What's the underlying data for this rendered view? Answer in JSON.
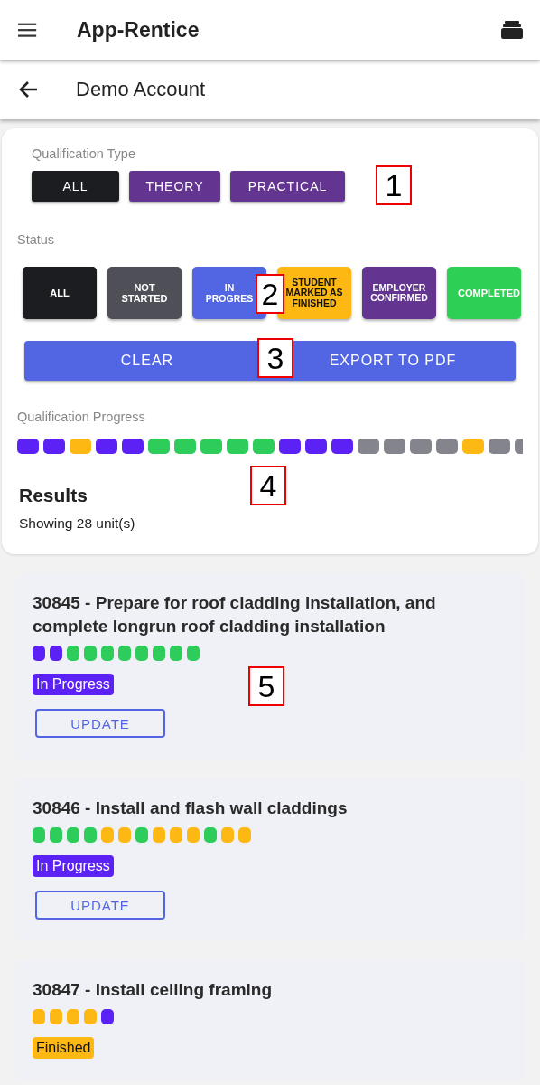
{
  "app_bar": {
    "title": "App-Rentice"
  },
  "page_header": {
    "title": "Demo Account"
  },
  "filters": {
    "qualification_label": "Qualification Type",
    "qualification_types": [
      {
        "label": "ALL",
        "selected": true
      },
      {
        "label": "THEORY",
        "selected": false
      },
      {
        "label": "PRACTICAL",
        "selected": false
      }
    ],
    "status_label": "Status",
    "statuses": [
      {
        "label": "ALL",
        "selected": true,
        "color": "#1c1d21"
      },
      {
        "label": "NOT STARTED",
        "selected": false,
        "color": "#4f5057"
      },
      {
        "label": "IN PROGRES",
        "selected": false,
        "color": "#5266e3"
      },
      {
        "label": "STUDENT MARKED AS FINISHED",
        "selected": false,
        "color": "#fdb813"
      },
      {
        "label": "EMPLOYER CONFIRMED",
        "selected": false,
        "color": "#633590"
      },
      {
        "label": "COMPLETED",
        "selected": false,
        "color": "#2ecf55"
      }
    ],
    "actions": [
      "CLEAR",
      "EXPORT TO PDF"
    ]
  },
  "progress": {
    "label": "Qualification Progress",
    "segments": [
      {
        "color": "#5b21f5"
      },
      {
        "color": "#5b21f5"
      },
      {
        "color": "#fdb813"
      },
      {
        "color": "#5b21f5"
      },
      {
        "color": "#5b21f5"
      },
      {
        "color": "#2ecc5a"
      },
      {
        "color": "#2ecc5a"
      },
      {
        "color": "#2ecc5a"
      },
      {
        "color": "#2ecc5a"
      },
      {
        "color": "#2ecc5a"
      },
      {
        "color": "#5b21f5"
      },
      {
        "color": "#5b21f5"
      },
      {
        "color": "#5b21f5"
      },
      {
        "color": "#84848c"
      },
      {
        "color": "#84848c"
      },
      {
        "color": "#84848c"
      },
      {
        "color": "#84848c"
      },
      {
        "color": "#fdb813"
      },
      {
        "color": "#84848c"
      },
      {
        "color": "#84848c"
      }
    ]
  },
  "results": {
    "title": "Results",
    "summary": "Showing 28 unit(s)"
  },
  "units": [
    {
      "title": "30845 - Prepare for roof cladding installation, and complete longrun roof cladding installation",
      "status": {
        "text": "In Progress",
        "color": "#5b21f5"
      },
      "button": "UPDATE",
      "segments": [
        {
          "color": "#5b21f5"
        },
        {
          "color": "#5b21f5"
        },
        {
          "color": "#2ecc5a"
        },
        {
          "color": "#2ecc5a"
        },
        {
          "color": "#2ecc5a"
        },
        {
          "color": "#2ecc5a"
        },
        {
          "color": "#2ecc5a"
        },
        {
          "color": "#2ecc5a"
        },
        {
          "color": "#2ecc5a"
        },
        {
          "color": "#2ecc5a"
        }
      ]
    },
    {
      "title": "30846 - Install and flash wall claddings",
      "status": {
        "text": "In Progress",
        "color": "#5b21f5"
      },
      "button": "UPDATE",
      "segments": [
        {
          "color": "#2ecc5a"
        },
        {
          "color": "#2ecc5a"
        },
        {
          "color": "#2ecc5a"
        },
        {
          "color": "#2ecc5a"
        },
        {
          "color": "#fdb813"
        },
        {
          "color": "#fdb813"
        },
        {
          "color": "#2ecc5a"
        },
        {
          "color": "#fdb813"
        },
        {
          "color": "#fdb813"
        },
        {
          "color": "#fdb813"
        },
        {
          "color": "#2ecc5a"
        },
        {
          "color": "#fdb813"
        },
        {
          "color": "#fdb813"
        }
      ]
    },
    {
      "title": "30847 - Install ceiling framing",
      "status": {
        "text": "Finished",
        "color": "#fdb813"
      },
      "segments": [
        {
          "color": "#fdb813"
        },
        {
          "color": "#fdb813"
        },
        {
          "color": "#fdb813"
        },
        {
          "color": "#fdb813"
        },
        {
          "color": "#5b21f5"
        }
      ]
    }
  ],
  "annotations": [
    "1",
    "2",
    "3",
    "4",
    "5"
  ]
}
